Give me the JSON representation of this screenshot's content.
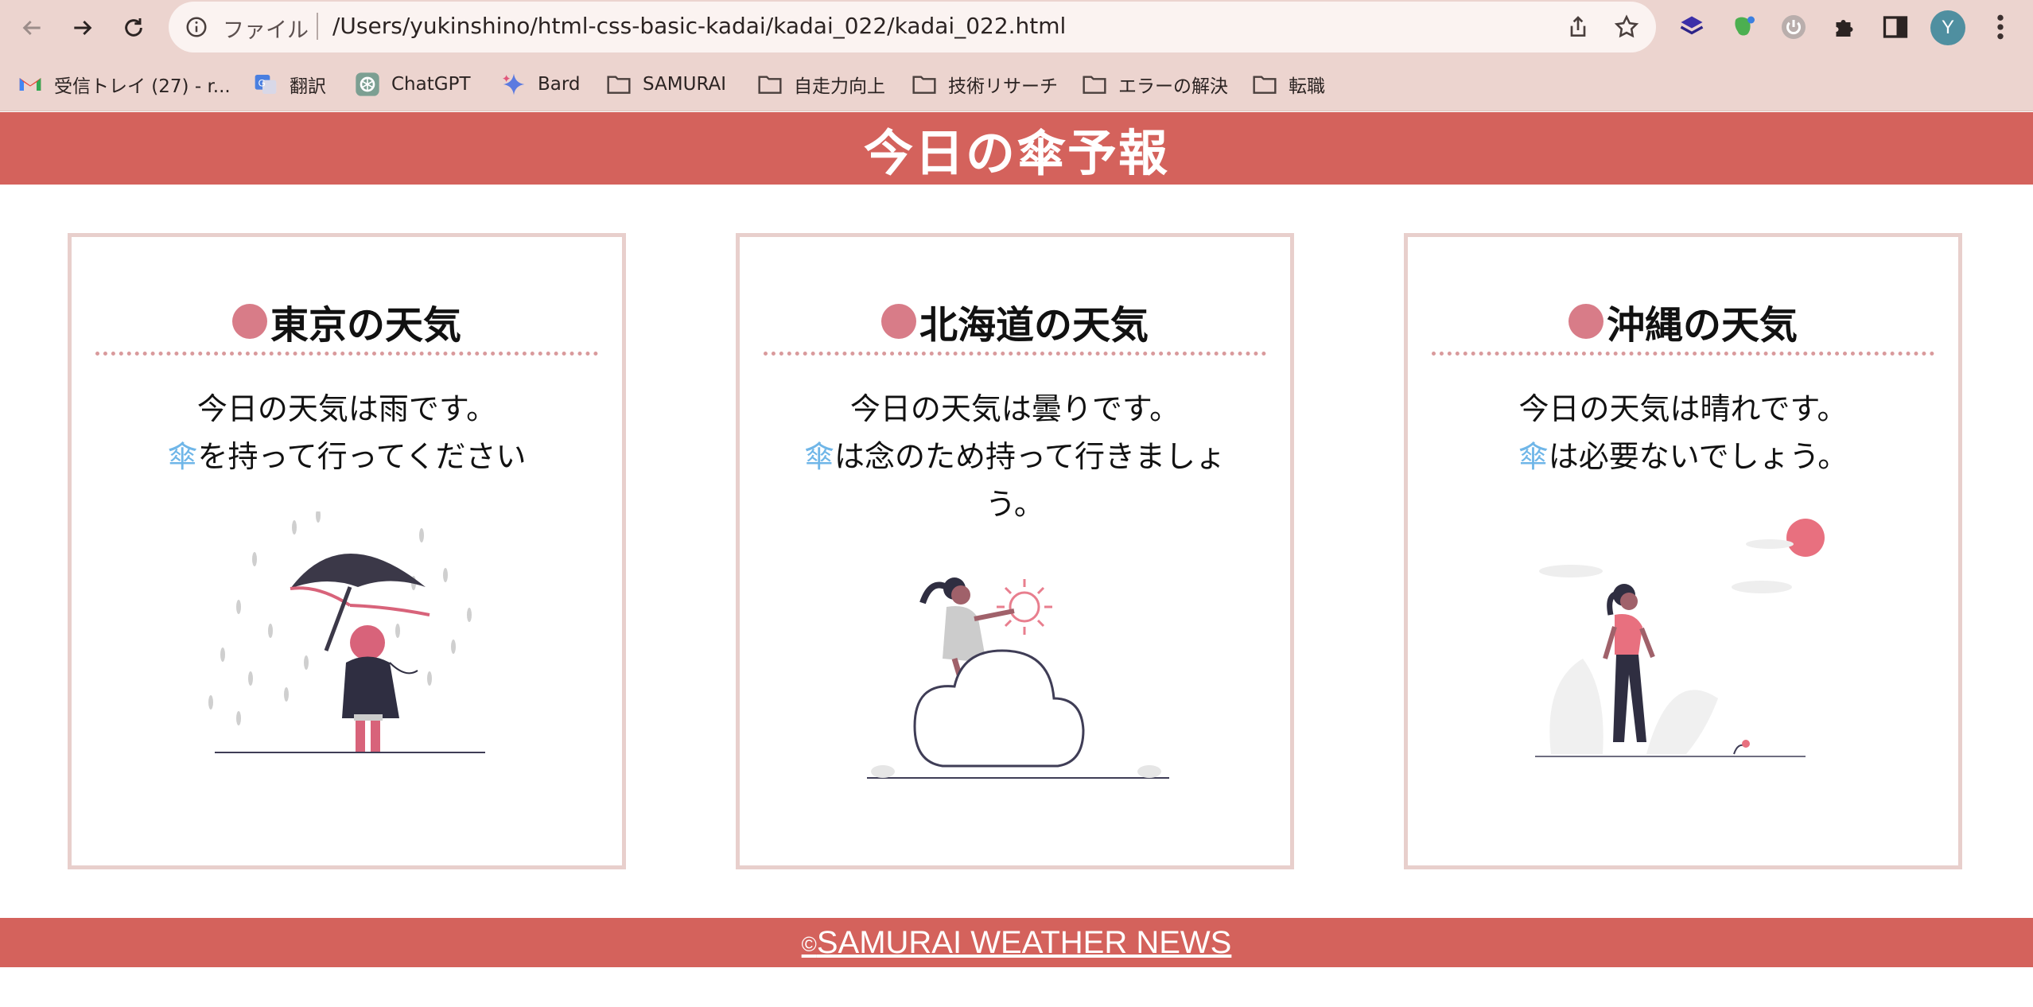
{
  "browser": {
    "omnibox": {
      "scheme_label": "ファイル",
      "url": "/Users/yukinshino/html-css-basic-kadai/kadai_022/kadai_022.html"
    },
    "profile_initial": "Y",
    "bookmarks": [
      {
        "label": "受信トレイ (27) - r...",
        "icon": "gmail-icon"
      },
      {
        "label": "翻訳",
        "icon": "translate-icon"
      },
      {
        "label": "ChatGPT",
        "icon": "chatgpt-icon"
      },
      {
        "label": "Bard",
        "icon": "bard-icon"
      },
      {
        "label": "SAMURAI",
        "icon": "folder-icon"
      },
      {
        "label": "自走力向上",
        "icon": "folder-icon"
      },
      {
        "label": "技術リサーチ",
        "icon": "folder-icon"
      },
      {
        "label": "エラーの解決",
        "icon": "folder-icon"
      },
      {
        "label": "転職",
        "icon": "folder-icon"
      }
    ]
  },
  "page": {
    "title": "今日の傘予報",
    "colors": {
      "header_bg": "#d4625c",
      "card_border": "#e8cfcc",
      "dot": "#d87c88",
      "umbrella_glyph": "#6fb6e8"
    },
    "cards": [
      {
        "title": "東京の天気",
        "line1": "今日の天気は雨です。",
        "umbrella": "傘",
        "line2": "を持って行ってください",
        "illustration": "woman-with-umbrella-in-rain"
      },
      {
        "title": "北海道の天気",
        "line1": "今日の天気は曇りです。",
        "umbrella": "傘",
        "line2": "は念のため持って行きましょう。",
        "illustration": "woman-on-cloud-with-sun"
      },
      {
        "title": "沖縄の天気",
        "line1": "今日の天気は晴れです。",
        "umbrella": "傘",
        "line2": "は必要ないでしょう。",
        "illustration": "woman-walking-sunny"
      }
    ],
    "footer": {
      "copyright": "©",
      "text": "SAMURAI WEATHER NEWS"
    }
  }
}
